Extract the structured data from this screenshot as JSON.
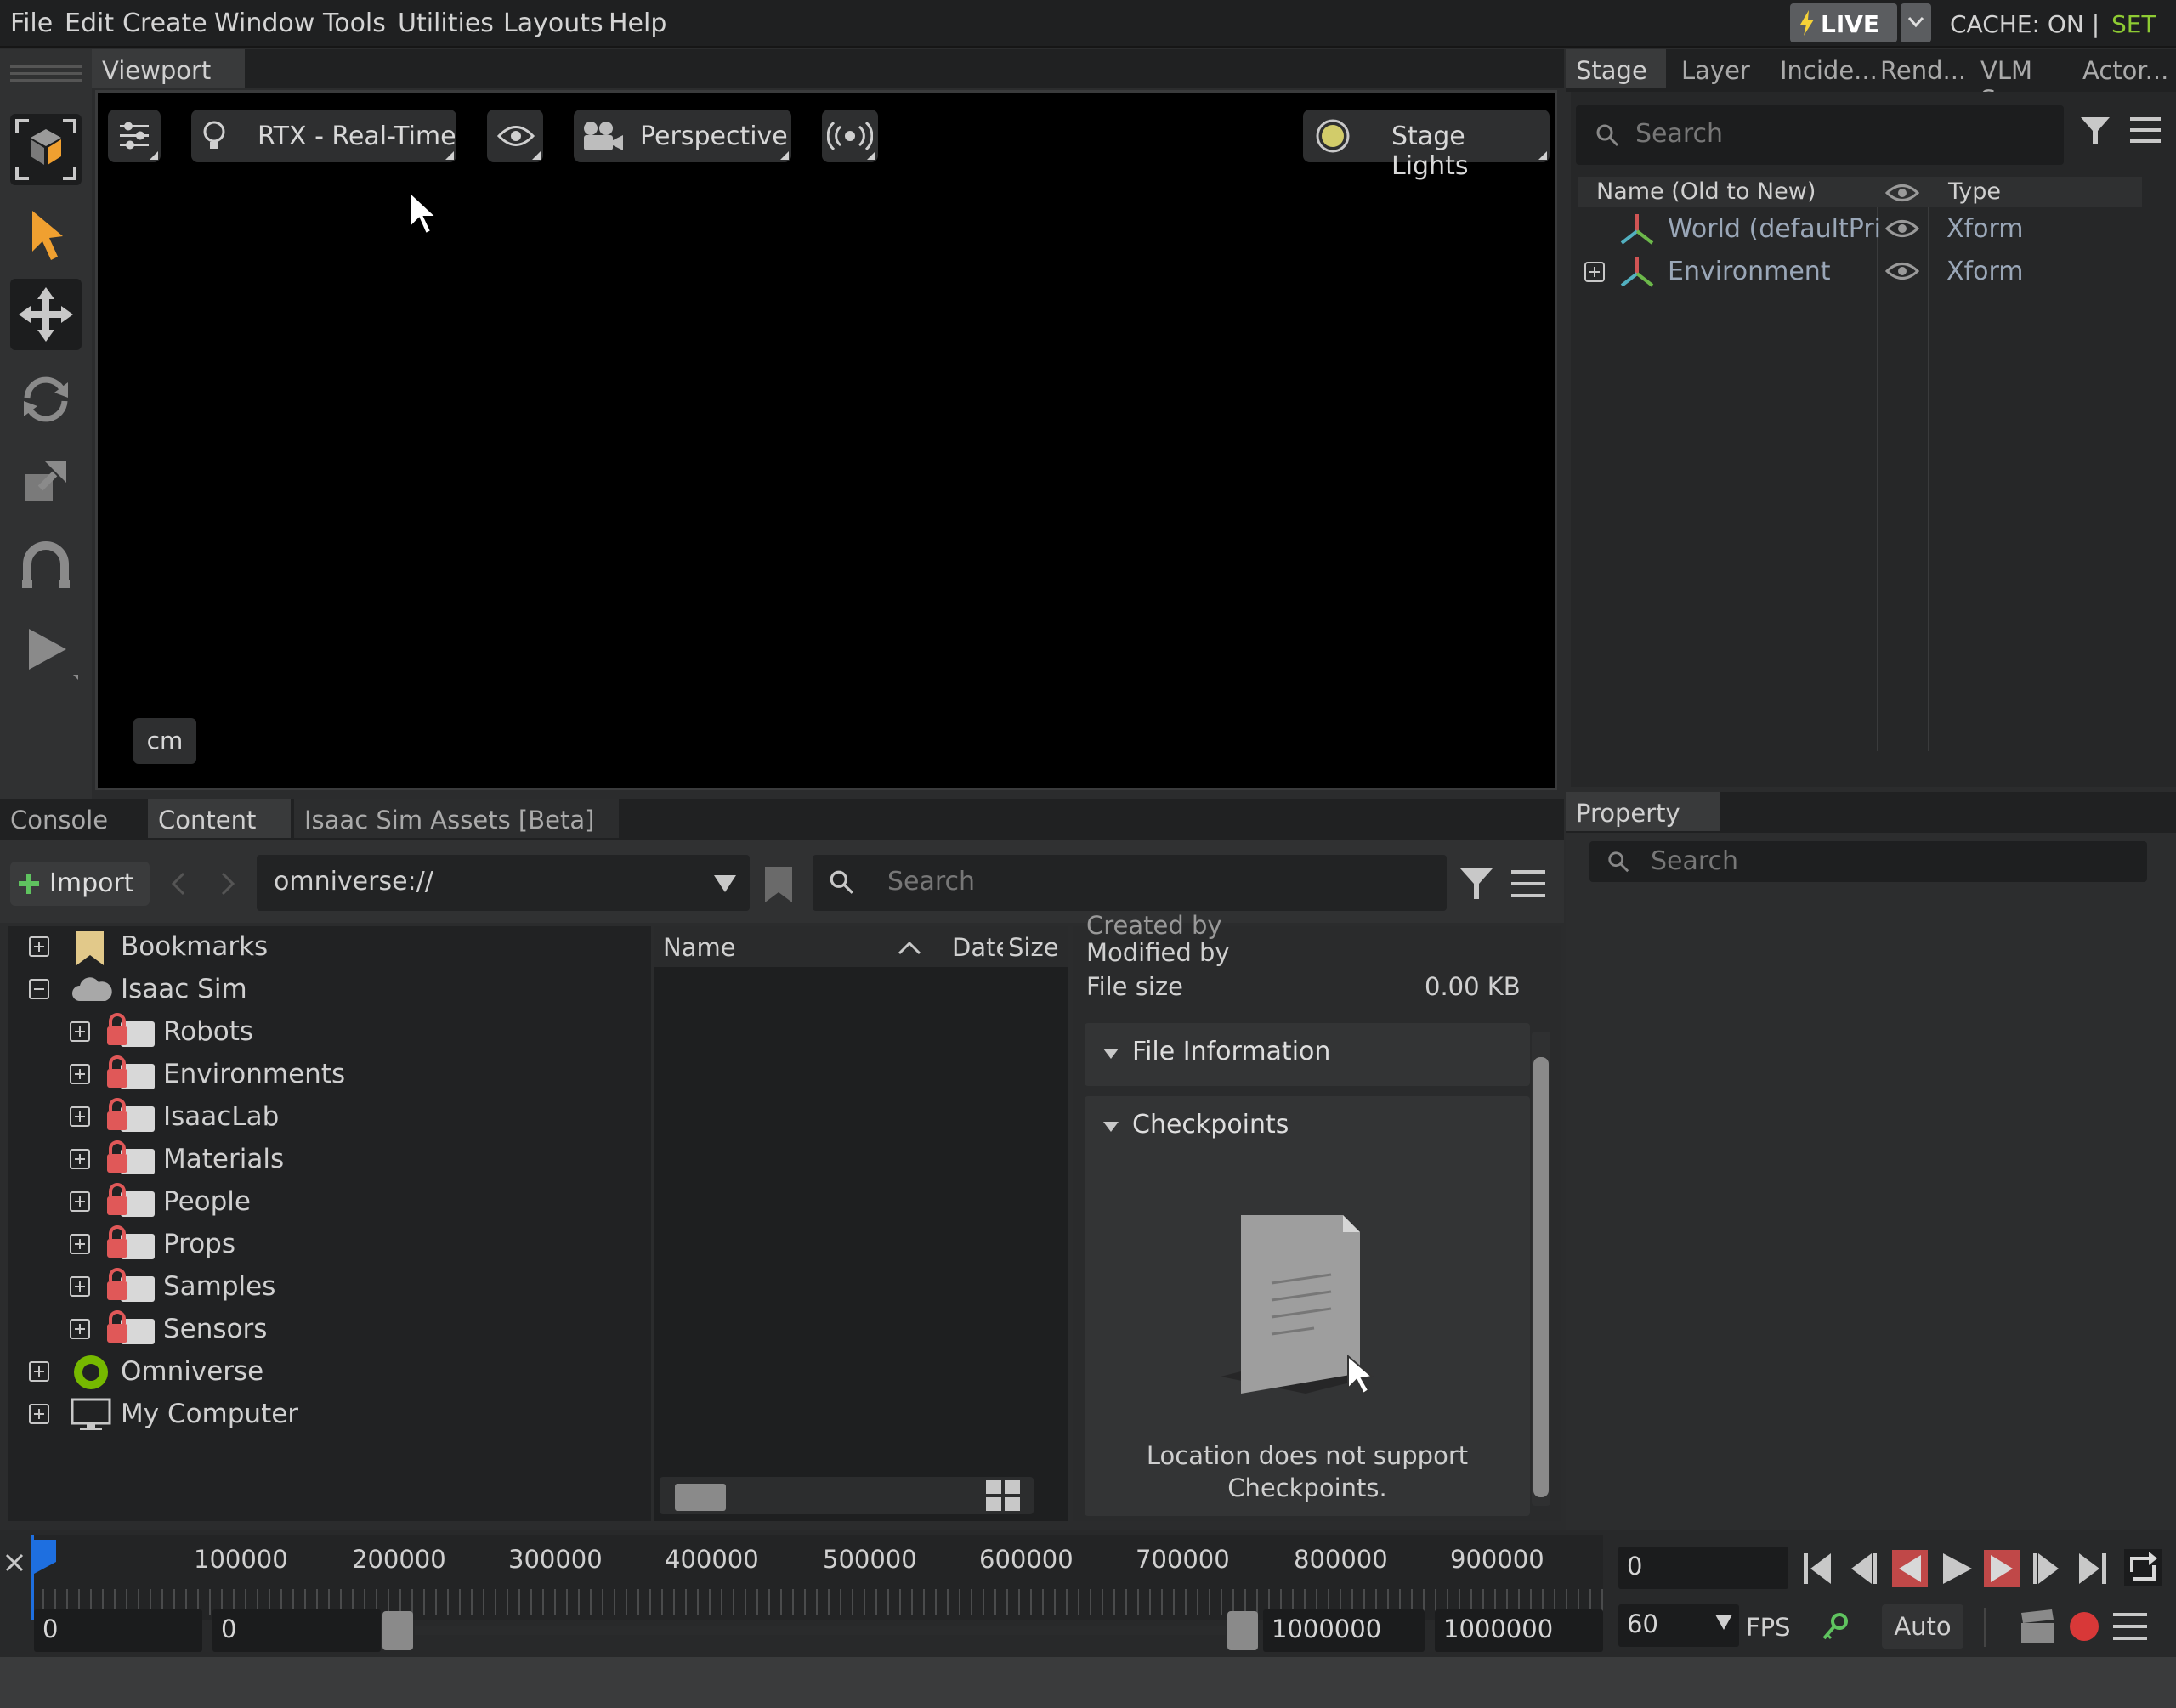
{
  "menu": {
    "items": [
      "File",
      "Edit",
      "Create",
      "Window",
      "Tools",
      "Utilities",
      "Layouts",
      "Help"
    ],
    "live_label": "LIVE",
    "cache_label": "CACHE: ON |",
    "set_label": "SET"
  },
  "viewport": {
    "tab_label": "Viewport",
    "render_mode": "RTX - Real-Time",
    "camera": "Perspective",
    "lights": "Stage Lights",
    "units": "cm"
  },
  "stage": {
    "tabs": [
      "Stage",
      "Layer",
      "Incide...",
      "Rend...",
      "VLM S...",
      "Actor..."
    ],
    "search_placeholder": "Search",
    "col_name": "Name (Old to New)",
    "col_type": "Type",
    "rows": [
      {
        "name": "World (defaultPri",
        "type": "Xform"
      },
      {
        "name": "Environment",
        "type": "Xform"
      }
    ]
  },
  "property": {
    "tab_label": "Property",
    "search_placeholder": "Search"
  },
  "content": {
    "tabs": [
      "Console",
      "Content",
      "Isaac Sim Assets [Beta]"
    ],
    "import_label": "Import",
    "path": "omniverse://",
    "search_placeholder": "Search",
    "tree": [
      {
        "label": "Bookmarks"
      },
      {
        "label": "Isaac Sim"
      },
      {
        "label": "Robots"
      },
      {
        "label": "Environments"
      },
      {
        "label": "IsaacLab"
      },
      {
        "label": "Materials"
      },
      {
        "label": "People"
      },
      {
        "label": "Props"
      },
      {
        "label": "Samples"
      },
      {
        "label": "Sensors"
      },
      {
        "label": "Omniverse"
      },
      {
        "label": "My Computer"
      }
    ],
    "list_col_name": "Name",
    "list_col_date": "Date",
    "list_col_size": "Size",
    "details": {
      "created_by": "Created by",
      "modified_by": "Modified by",
      "file_size_label": "File size",
      "file_size_value": "0.00 KB",
      "file_info": "File Information",
      "checkpoints": "Checkpoints",
      "no_checkpoints_line1": "Location does not support",
      "no_checkpoints_line2": "Checkpoints."
    }
  },
  "timeline": {
    "ticks": [
      "100000",
      "200000",
      "300000",
      "400000",
      "500000",
      "600000",
      "700000",
      "800000",
      "900000"
    ],
    "current_frame": "0",
    "start_a": "0",
    "start_b": "0",
    "end_a": "1000000",
    "end_b": "1000000",
    "fps_value": "60",
    "fps_label": "FPS",
    "auto_label": "Auto"
  },
  "colors": {
    "accent_orange": "#f0a030",
    "live_yellow": "#f5d238",
    "set_green": "#8ecb33",
    "timeline_blue": "#1e6fe0",
    "record_red": "#d83838"
  }
}
